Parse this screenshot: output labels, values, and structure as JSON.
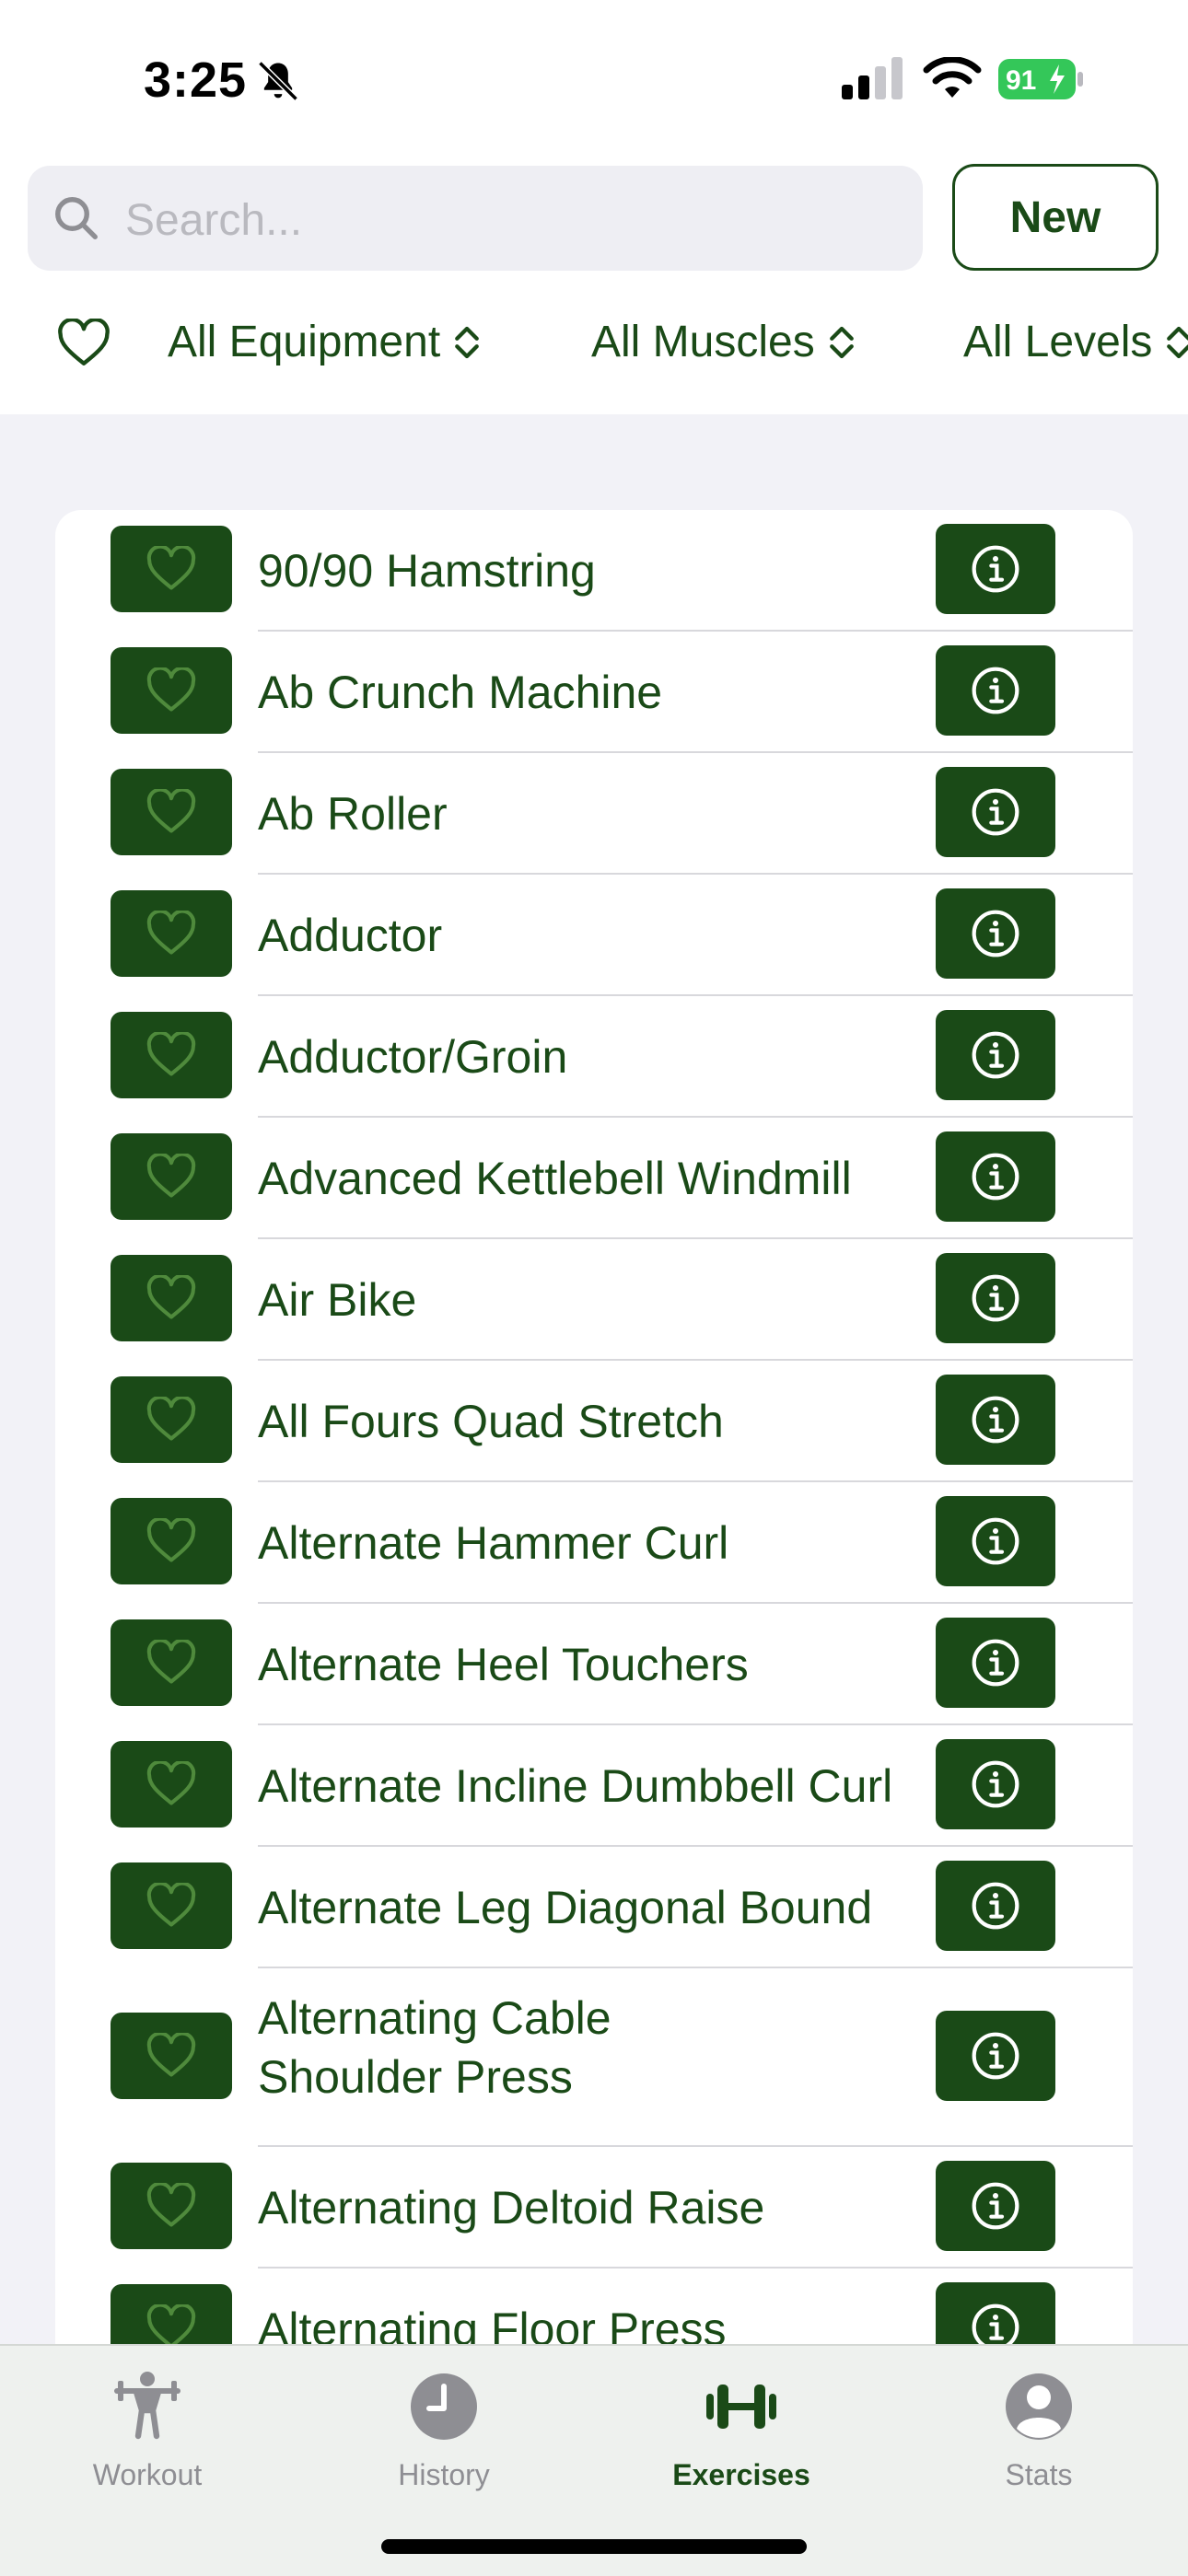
{
  "status": {
    "time": "3:25",
    "battery": "91"
  },
  "search": {
    "placeholder": "Search..."
  },
  "toolbar": {
    "new_label": "New"
  },
  "filters": {
    "equipment": "All Equipment",
    "muscles": "All Muscles",
    "levels": "All Levels"
  },
  "exercises": [
    "90/90 Hamstring",
    "Ab Crunch Machine",
    "Ab Roller",
    "Adductor",
    "Adductor/Groin",
    "Advanced Kettlebell Windmill",
    "Air Bike",
    "All Fours Quad Stretch",
    "Alternate Hammer Curl",
    "Alternate Heel Touchers",
    "Alternate Incline Dumbbell Curl",
    "Alternate Leg Diagonal Bound",
    "Alternating Cable Shoulder Press",
    "Alternating Deltoid Raise",
    "Alternating Floor Press"
  ],
  "tabs": {
    "workout": "Workout",
    "history": "History",
    "exercises": "Exercises",
    "stats": "Stats"
  },
  "colors": {
    "accent": "#1a4a17",
    "heart": "#4f8a3c"
  }
}
